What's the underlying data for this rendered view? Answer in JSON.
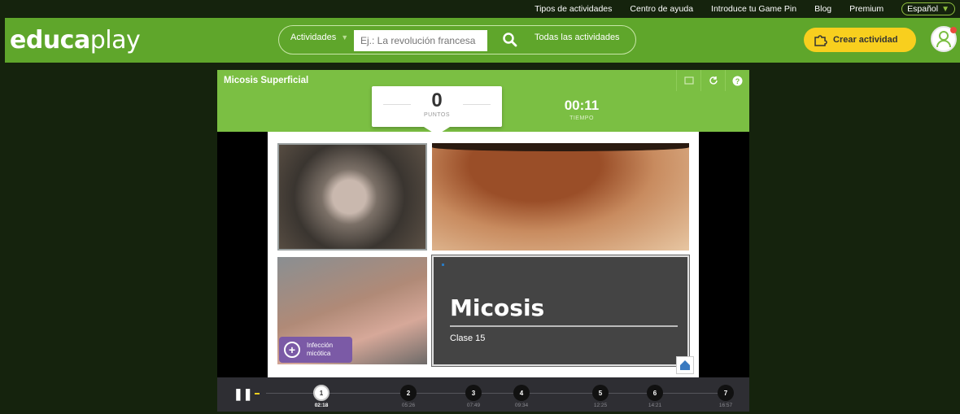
{
  "toplinks": {
    "tipos": "Tipos de actividades",
    "ayuda": "Centro de ayuda",
    "gamepin": "Introduce tu Game Pin",
    "blog": "Blog",
    "premium": "Premium",
    "language": "Español"
  },
  "header": {
    "logo_pre": "educa",
    "logo_post": "play",
    "search": {
      "category_label": "Actividades",
      "placeholder": "Ej.: La revolución francesa",
      "all_activities": "Todas las actividades"
    },
    "create_label": "Crear actividad"
  },
  "activity": {
    "title": "Micosis Superficial",
    "points_value": "0",
    "points_label": "PUNTOS",
    "time_value": "00:11",
    "time_label": "TIEMPO",
    "slide": {
      "title": "Micosis",
      "subtitle": "Clase 15",
      "badge_line1": "Infección",
      "badge_line2": "micótica"
    },
    "markers": [
      {
        "num": "1",
        "time": "02:18",
        "active": true
      },
      {
        "num": "2",
        "time": "05:26",
        "active": false
      },
      {
        "num": "3",
        "time": "07:49",
        "active": false
      },
      {
        "num": "4",
        "time": "09:34",
        "active": false
      },
      {
        "num": "5",
        "time": "12:25",
        "active": false
      },
      {
        "num": "6",
        "time": "14:21",
        "active": false
      },
      {
        "num": "7",
        "time": "16:57",
        "active": false
      }
    ]
  },
  "colors": {
    "header_green": "#5fa62b",
    "activity_green": "#7bbf43",
    "create_yellow": "#f8cf1e"
  }
}
